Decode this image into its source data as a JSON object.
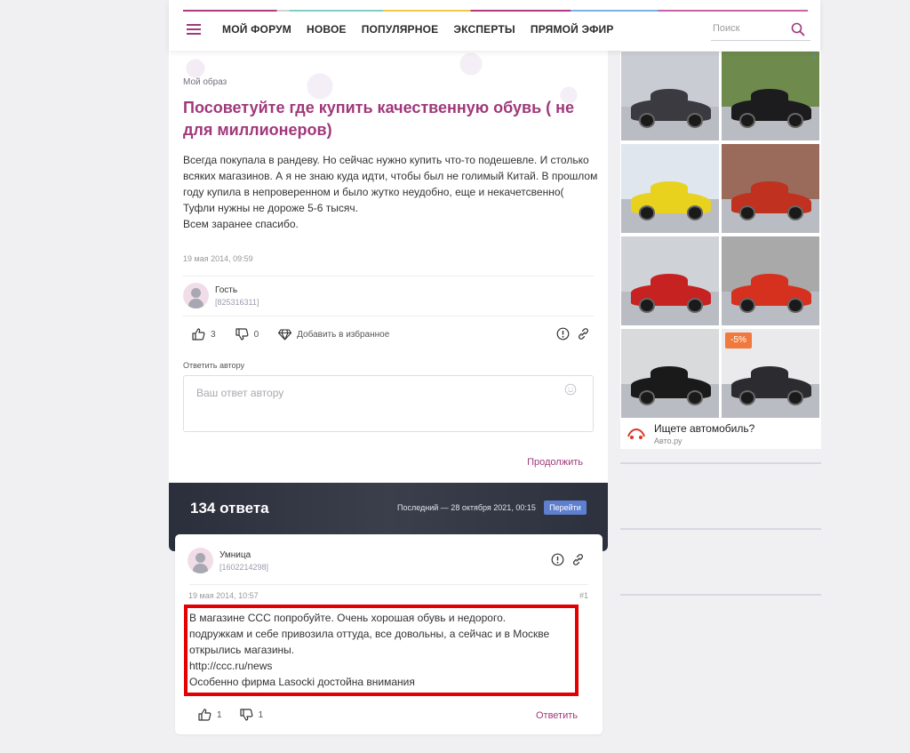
{
  "header": {
    "nav": [
      "Мой форум",
      "Новое",
      "Популярное",
      "Эксперты",
      "Прямой эфир"
    ],
    "search_placeholder": "Поиск",
    "accent": "#a0387b"
  },
  "post": {
    "category": "Мой образ",
    "title": "Посоветуйте где купить качественную обувь ( не для миллионеров)",
    "body": "Всегда покупала в рандеву. Но сейчас нужно купить что-то подешевле. И столько всяких магазинов. А я не знаю куда идти, чтобы был не голимый Китай. В прошлом году купила в непроверенном и было жутко неудобно, еще и некачетсвенно(\nТуфли нужны не дороже 5-6 тысяч.\nВсем заранее спасибо.",
    "date": "19 мая 2014, 09:59",
    "author": {
      "name": "Гость",
      "id": "[825316311]"
    },
    "likes": "3",
    "dislikes": "0",
    "favorite_label": "Добавить в избранное",
    "reply_label": "Ответить автору",
    "reply_placeholder": "Ваш ответ автору",
    "continue_label": "Продолжить"
  },
  "answers": {
    "count_label": "134 ответа",
    "last": "Последний — 28 октября 2021, 00:15",
    "go_label": "Перейти"
  },
  "answer": {
    "author": {
      "name": "Умница",
      "id": "[1602214298]"
    },
    "date": "19 мая 2014, 10:57",
    "number": "#1",
    "text": "В магазине ССС попробуйте. Очень хорошая обувь и недорого.\nподружкам и себе привозила оттуда, все довольны, а сейчас и в Москве открылись магазины.\nhttp://ccc.ru/news\nОсобенно фирма Lasocki достойна внимания",
    "likes": "1",
    "dislikes": "1",
    "reply_label": "Ответить"
  },
  "ad": {
    "title": "Ищете автомобиль?",
    "source": "Авто.ру",
    "discount_badge": "-5%",
    "info_icon": "i",
    "cars": [
      {
        "bg": "#c9ccd3",
        "color": "#3a3a40"
      },
      {
        "bg": "#6e8a4c",
        "color": "#1c1c1e"
      },
      {
        "bg": "#dfe6ee",
        "color": "#e8d21e"
      },
      {
        "bg": "#9a6a5a",
        "color": "#c0311f"
      },
      {
        "bg": "#cfd3d8",
        "color": "#c62222"
      },
      {
        "bg": "#a9a9a9",
        "color": "#d6301f"
      },
      {
        "bg": "#d9dadb",
        "color": "#1a1a1a"
      },
      {
        "bg": "#eaeaec",
        "color": "#2c2c30"
      }
    ]
  }
}
